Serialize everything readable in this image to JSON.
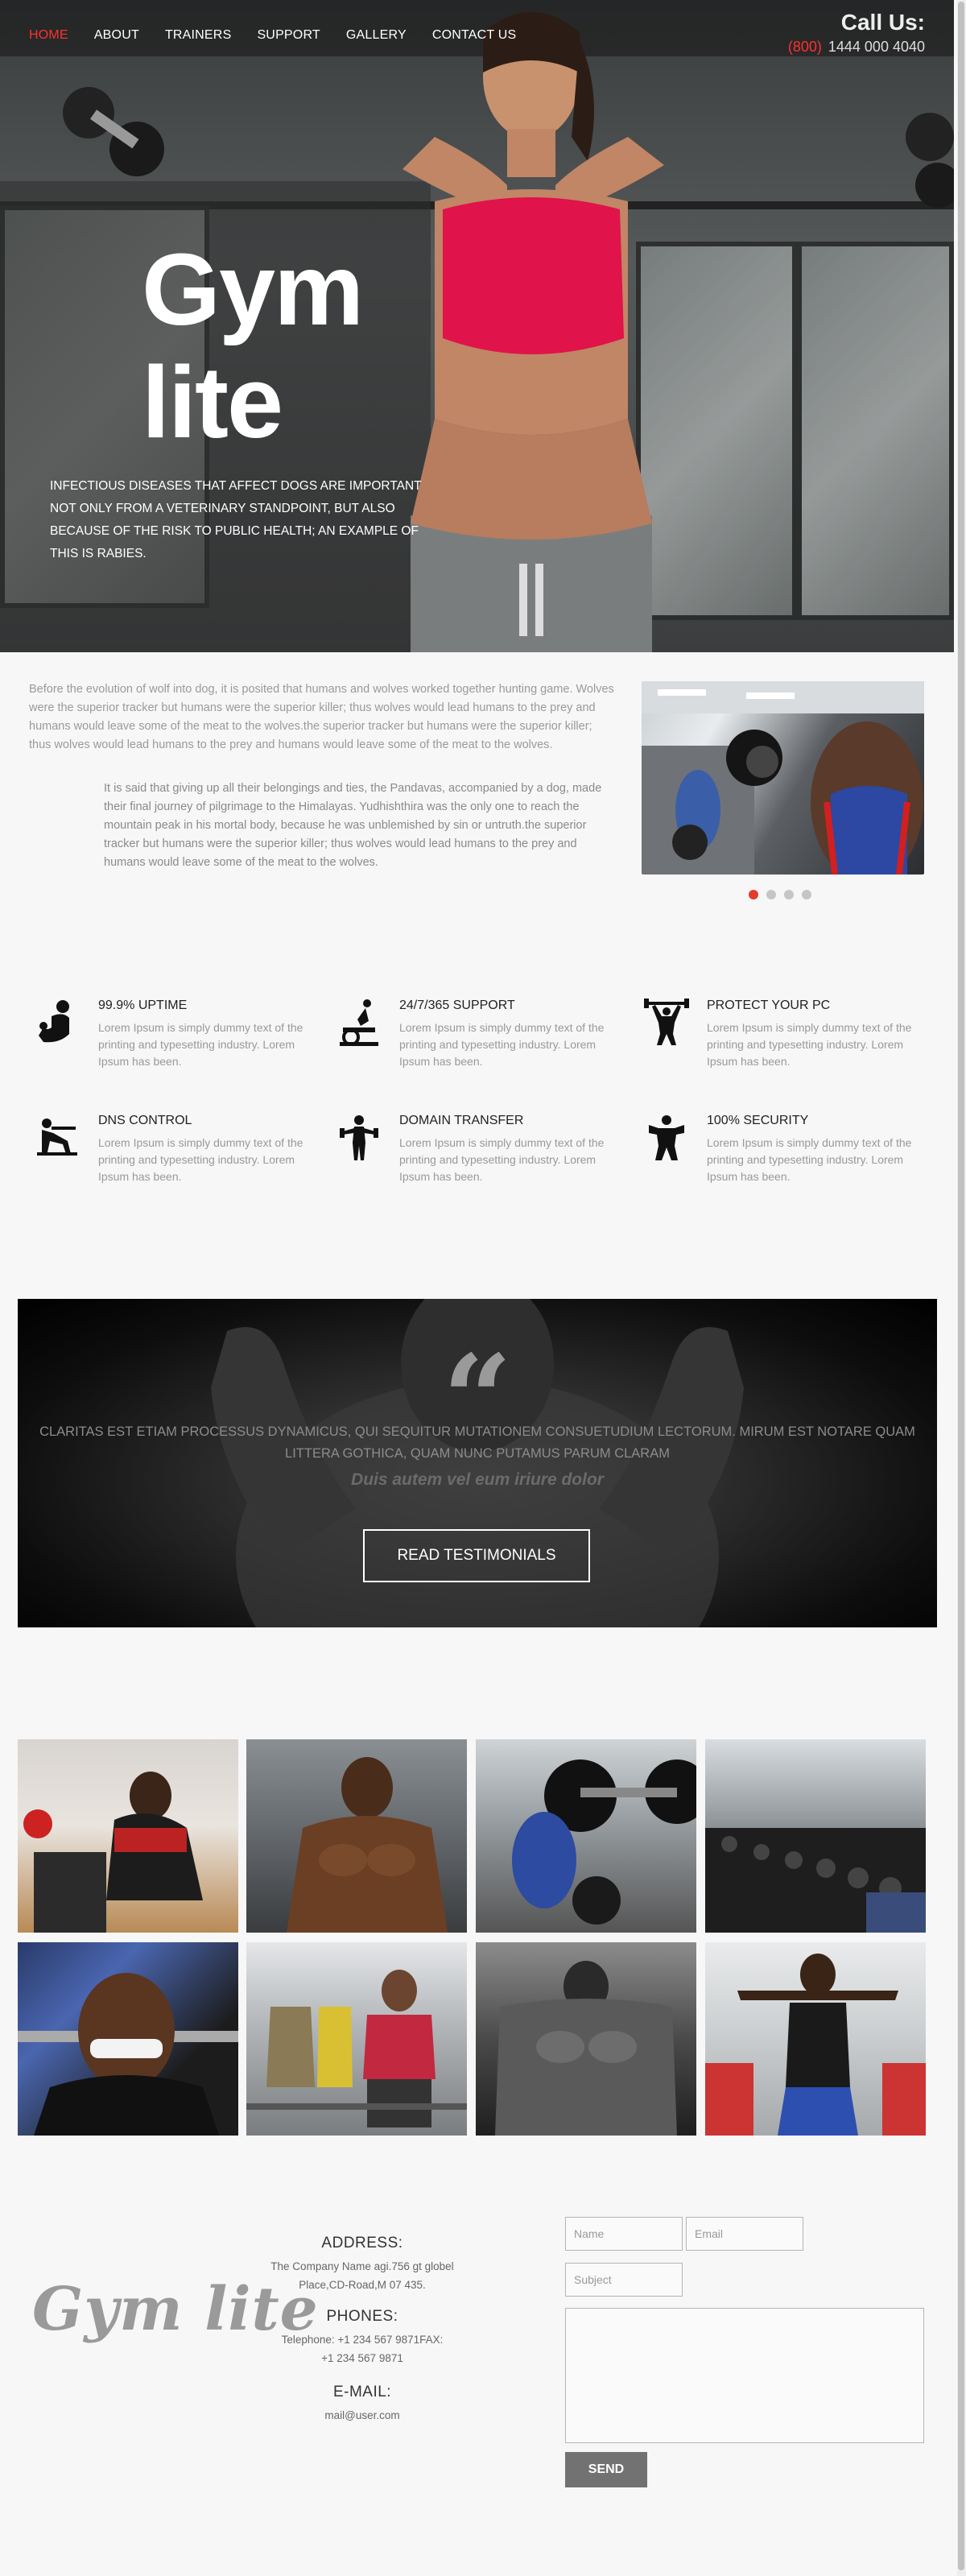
{
  "nav": {
    "items": [
      {
        "label": "HOME",
        "active": true
      },
      {
        "label": "ABOUT",
        "active": false
      },
      {
        "label": "TRAINERS",
        "active": false
      },
      {
        "label": "SUPPORT",
        "active": false
      },
      {
        "label": "GALLERY",
        "active": false
      },
      {
        "label": "CONTACT US",
        "active": false
      }
    ]
  },
  "call": {
    "title": "Call Us:",
    "code": "(800)",
    "number": "1444 000 4040"
  },
  "hero": {
    "title_line1": "Gym",
    "title_line2": "lite",
    "subtitle": "INFECTIOUS DISEASES THAT AFFECT DOGS ARE IMPORTANT NOT ONLY FROM A VETERINARY STANDPOINT, BUT ALSO BECAUSE OF THE RISK TO PUBLIC HEALTH; AN EXAMPLE OF THIS IS RABIES."
  },
  "intro": {
    "p1": "Before the evolution of wolf into dog, it is posited that humans and wolves worked together hunting game. Wolves were the superior tracker but humans were the superior killer; thus wolves would lead humans to the prey and humans would leave some of the meat to the wolves.the superior tracker but humans were the superior killer; thus wolves would lead humans to the prey and humans would leave some of the meat to the wolves.",
    "p2": "It is said that giving up all their belongings and ties, the Pandavas, accompanied by a dog, made their final journey of pilgrimage to the Himalayas. Yudhishthira was the only one to reach the mountain peak in his mortal body, because he was unblemished by sin or untruth.the superior tracker but humans were the superior killer; thus wolves would lead humans to the prey and humans would leave some of the meat to the wolves.",
    "slider_dots": 4,
    "slider_active": 0
  },
  "features": [
    {
      "icon": "bodybuilder-icon",
      "title": "99.9% UPTIME",
      "text": "Lorem Ipsum is simply dummy text of the printing and typesetting industry. Lorem Ipsum has been."
    },
    {
      "icon": "exercise-bike-icon",
      "title": "24/7/365 SUPPORT",
      "text": "Lorem Ipsum is simply dummy text of the printing and typesetting industry. Lorem Ipsum has been."
    },
    {
      "icon": "weightlifter-icon",
      "title": "PROTECT YOUR PC",
      "text": "Lorem Ipsum is simply dummy text of the printing and typesetting industry. Lorem Ipsum has been."
    },
    {
      "icon": "bench-press-icon",
      "title": "DNS CONTROL",
      "text": "Lorem Ipsum is simply dummy text of the printing and typesetting industry. Lorem Ipsum has been."
    },
    {
      "icon": "dumbbell-man-icon",
      "title": "DOMAIN TRANSFER",
      "text": "Lorem Ipsum is simply dummy text of the printing and typesetting industry. Lorem Ipsum has been."
    },
    {
      "icon": "strongman-icon",
      "title": "100% SECURITY",
      "text": "Lorem Ipsum is simply dummy text of the printing and typesetting industry. Lorem Ipsum has been."
    }
  ],
  "testimonial": {
    "quote_mark": "“",
    "text": "CLARITAS EST ETIAM PROCESSUS DYNAMICUS, QUI SEQUITUR MUTATIONEM CONSUETUDIUM LECTORUM. MIRUM EST NOTARE QUAM LITTERA GOTHICA, QUAM NUNC PUTAMUS PARUM CLARAM",
    "author": "Duis autem vel eum iriure dolor",
    "button": "READ TESTIMONIALS"
  },
  "gallery_count": 8,
  "contact": {
    "logo": "Gym lite",
    "address_h": "ADDRESS:",
    "address_v1": "The Company Name agi.756 gt globel",
    "address_v2": "Place,CD-Road,M 07 435.",
    "phones_h": "PHONES:",
    "phones_v1": "Telephone: +1 234 567 9871FAX:",
    "phones_v2": "+1 234 567 9871",
    "email_h": "E-MAIL:",
    "email_v": "mail@user.com",
    "name_ph": "Name",
    "email_ph": "Email",
    "subject_ph": "Subject",
    "send": "SEND"
  },
  "colors": {
    "accent": "#ff3030",
    "dot_active": "#e53b2f"
  }
}
